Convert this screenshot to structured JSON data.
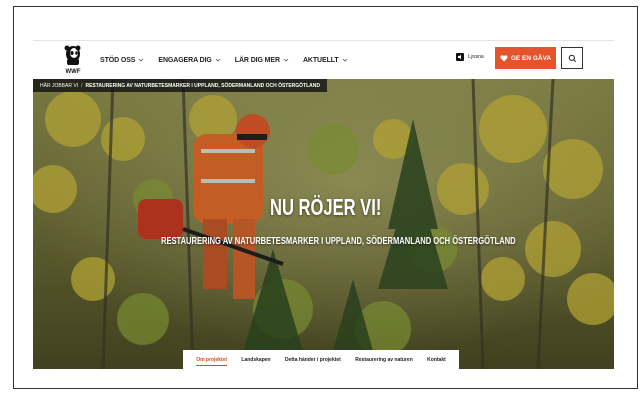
{
  "header": {
    "logo_text": "WWF",
    "nav": [
      {
        "label": "STÖD OSS"
      },
      {
        "label": "ENGAGERA DIG"
      },
      {
        "label": "LÄR DIG MER"
      },
      {
        "label": "AKTUELLT"
      }
    ],
    "listen_label": "Lyssna",
    "gift_label": "GE EN GÅVA",
    "accent_color": "#e5532d"
  },
  "breadcrumb": {
    "items": [
      "HÄR JOBBAR VI",
      "RESTAURERING AV NATURBETESMARKER I UPPLAND, SÖDERMANLAND OCH ÖSTERGÖTLAND"
    ],
    "separator": "/"
  },
  "hero": {
    "title": "NU RÖJER VI!",
    "subtitle": "RESTAURERING AV NATURBETESMARKER I UPPLAND, SÖDERMANLAND OCH ÖSTERGÖTLAND"
  },
  "tabs": [
    {
      "label": "Om projektet",
      "active": true
    },
    {
      "label": "Landskapen",
      "active": false
    },
    {
      "label": "Detta händer i projektet",
      "active": false
    },
    {
      "label": "Restaurering av naturen",
      "active": false
    },
    {
      "label": "Kontakt",
      "active": false
    }
  ]
}
